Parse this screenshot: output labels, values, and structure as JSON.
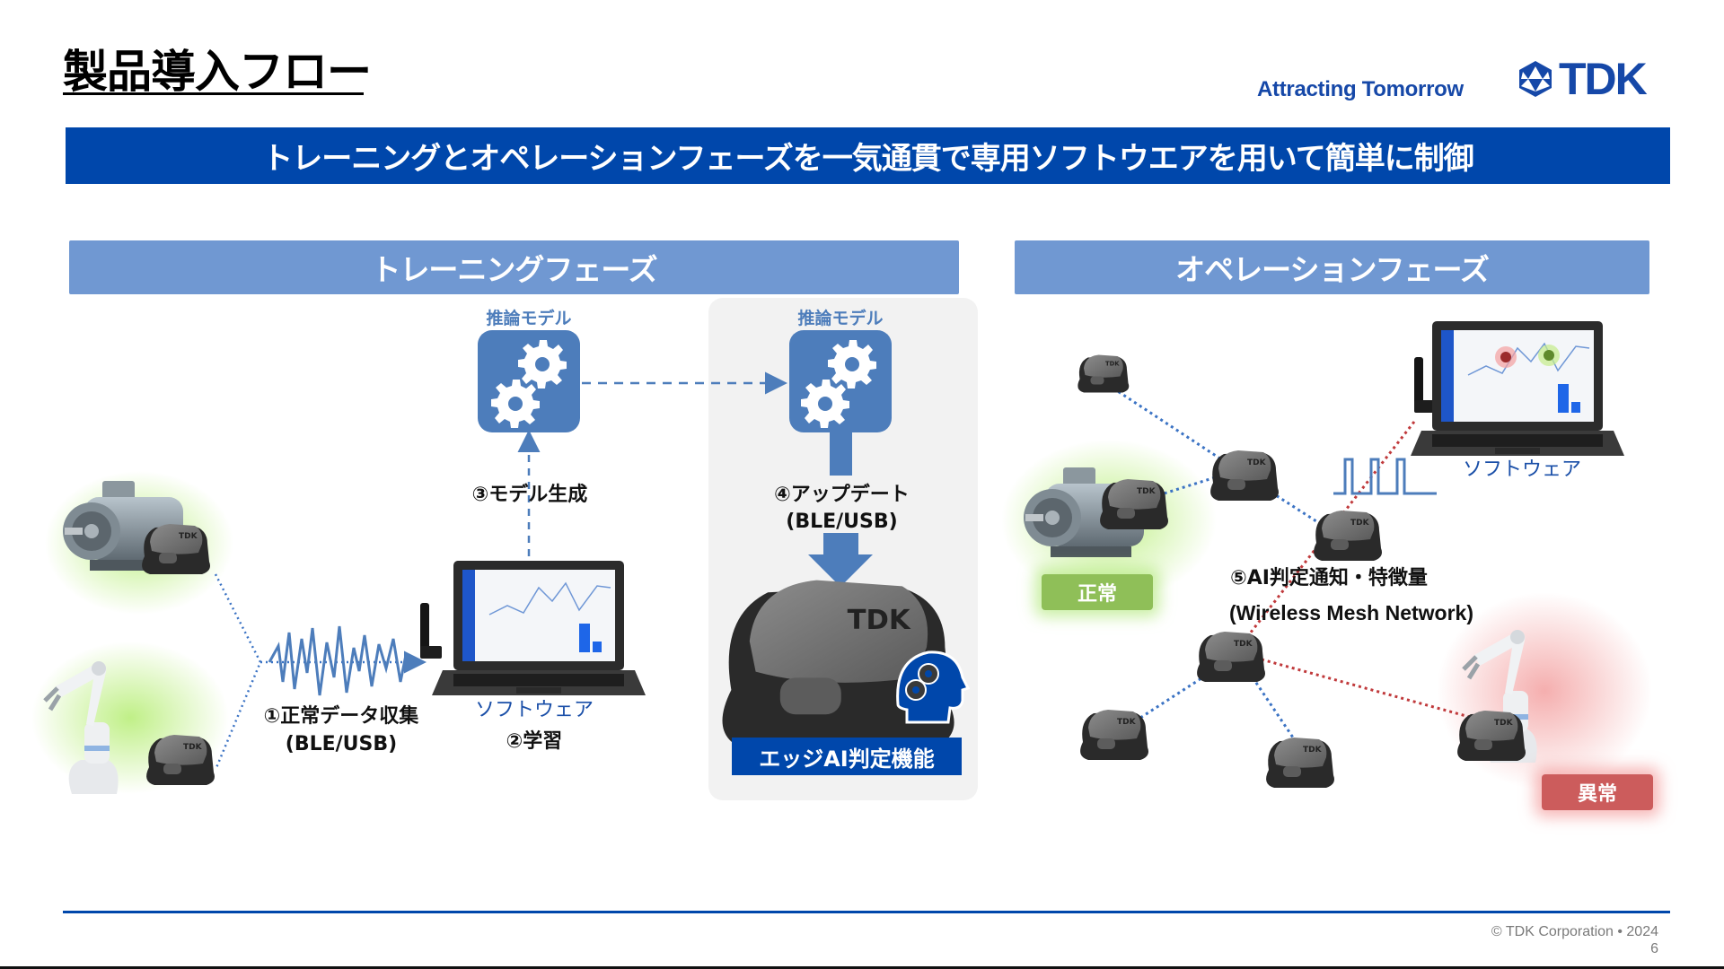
{
  "header": {
    "title": "製品導入フロー",
    "tagline": "Attracting Tomorrow",
    "logo_text": "TDK"
  },
  "banner": {
    "text": "トレーニングとオペレーションフェーズを一気通貫で専用ソフトウエアを用いて簡単に制御"
  },
  "training_phase": {
    "title": "トレーニングフェーズ",
    "step1_label": "①正常データ収集",
    "step1_sub": "(BLE/USB)",
    "software_label": "ソフトウェア",
    "step2_label": "②学習",
    "step3_label": "③モデル生成",
    "model_label": "推論モデル",
    "edge": {
      "model_label": "推論モデル",
      "step4_label": "④アップデート",
      "step4_sub": "(BLE/USB)",
      "edge_ai_label": "エッジAI判定機能"
    },
    "sensor_logo": "TDK"
  },
  "operation_phase": {
    "title": "オペレーションフェーズ",
    "software_label": "ソフトウェア",
    "step5_label": "⑤AI判定通知・特徴量",
    "step5_sub": "(Wireless Mesh Network)",
    "status_normal": "正常",
    "status_abnormal": "異常"
  },
  "colors": {
    "brand_blue": "#0047ab",
    "phase_header": "#7098d2",
    "model_blue": "#4d7dbb",
    "normal_green": "#8fbf58",
    "abnormal_red": "#cc5c5c",
    "mesh_blue_link": "#3b73c4",
    "alert_red_link": "#c0393b"
  },
  "footer": {
    "copyright": "© TDK Corporation • 2024",
    "page_number": "6"
  }
}
